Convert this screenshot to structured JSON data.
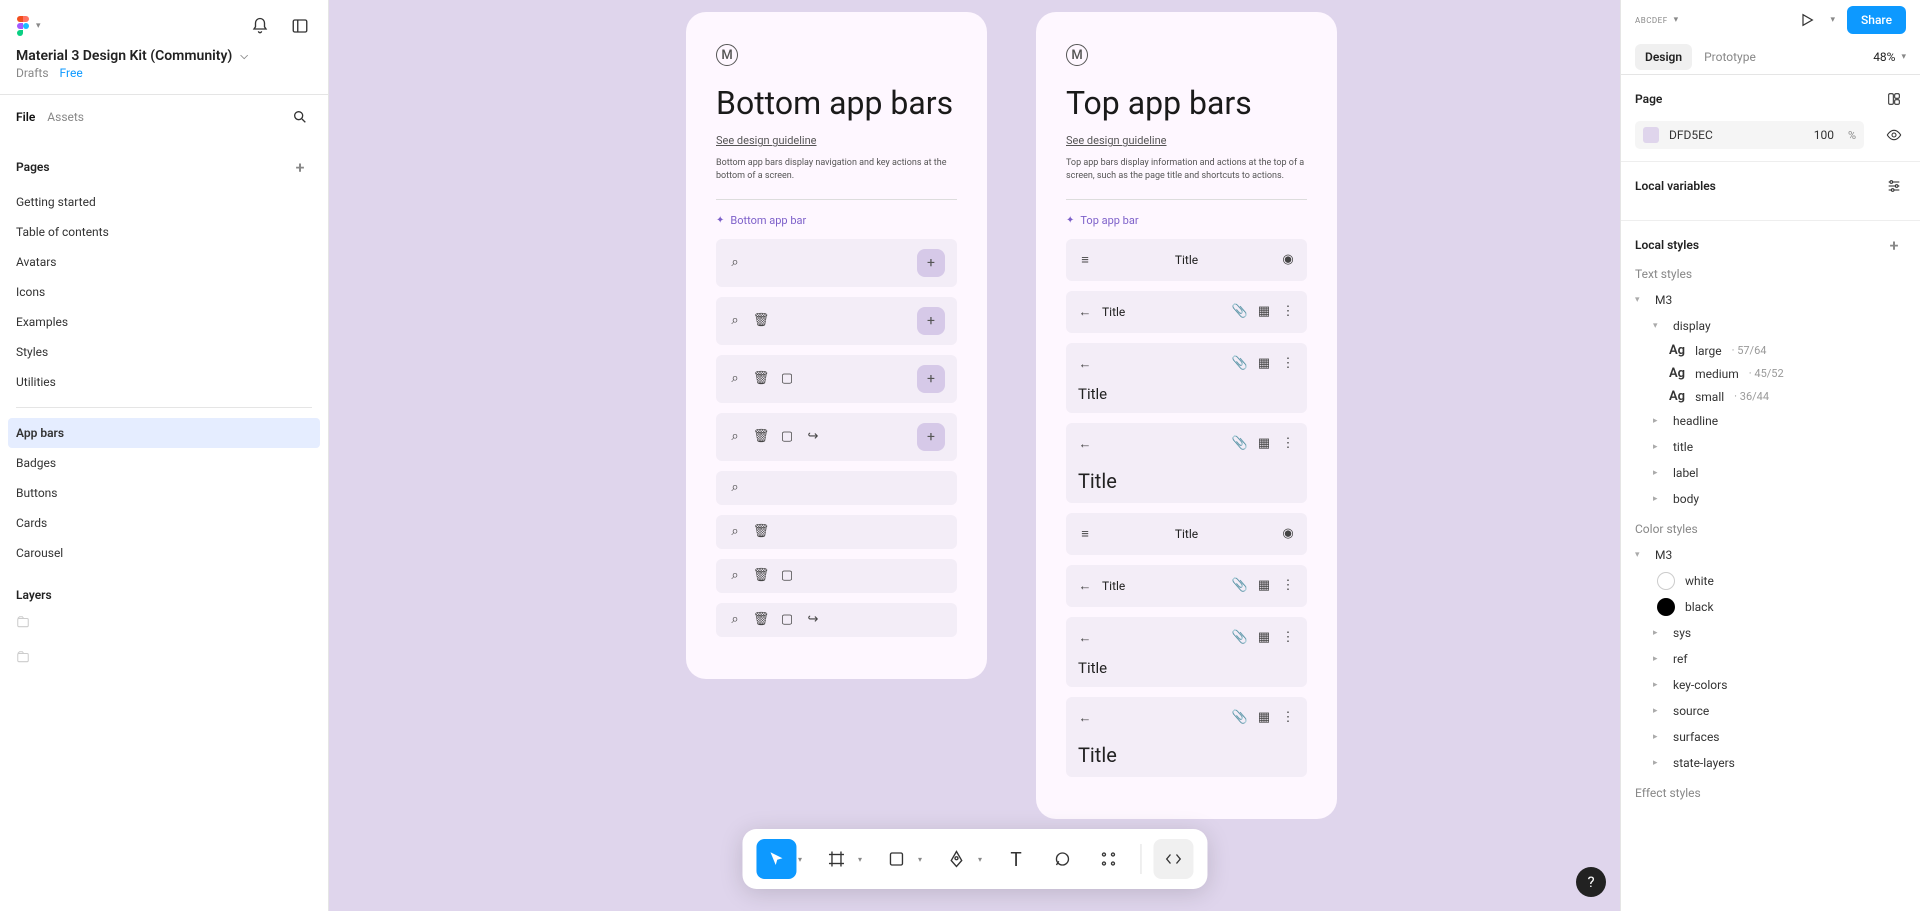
{
  "header": {
    "file_title": "Material 3 Design Kit (Community)",
    "sub_location": "Drafts",
    "plan": "Free"
  },
  "left_tabs": {
    "file": "File",
    "assets": "Assets"
  },
  "pages_label": "Pages",
  "layers_label": "Layers",
  "pages_top": [
    "Getting started",
    "Table of contents",
    "Avatars",
    "Icons",
    "Examples",
    "Styles",
    "Utilities"
  ],
  "pages_bottom": [
    "App bars",
    "Badges",
    "Buttons",
    "Cards",
    "Carousel"
  ],
  "pages_active_index": 0,
  "canvas": {
    "bg_hex": "DFD5EC",
    "bottom_card": {
      "title": "Bottom app bars",
      "link": "See design guideline",
      "desc": "Bottom app bars display navigation and key actions at the bottom of a screen.",
      "component_label": "Bottom app bar"
    },
    "top_card": {
      "title": "Top app bars",
      "link": "See design guideline",
      "desc": "Top app bars display information and actions at the top of a screen, such as the page title and shortcuts to actions.",
      "component_label": "Top app bar",
      "title_text": "Title"
    }
  },
  "right": {
    "share": "Share",
    "tabs": {
      "design": "Design",
      "prototype": "Prototype"
    },
    "zoom": "48%",
    "page_label": "Page",
    "page_hex": "DFD5EC",
    "page_opacity": "100",
    "page_pct": "%",
    "local_variables": "Local variables",
    "local_styles": "Local styles",
    "text_styles_label": "Text styles",
    "color_styles_label": "Color styles",
    "effect_styles_label": "Effect styles",
    "text_tree": {
      "root": "M3",
      "display": "display",
      "display_items": [
        {
          "name": "large",
          "meta": "57/64"
        },
        {
          "name": "medium",
          "meta": "45/52"
        },
        {
          "name": "small",
          "meta": "36/44"
        }
      ],
      "other": [
        "headline",
        "title",
        "label",
        "body"
      ]
    },
    "color_tree": {
      "root": "M3",
      "leaves": [
        {
          "name": "white",
          "swatch": "white"
        },
        {
          "name": "black",
          "swatch": "black"
        }
      ],
      "groups": [
        "sys",
        "ref",
        "key-colors",
        "source",
        "surfaces",
        "state-layers"
      ]
    }
  }
}
